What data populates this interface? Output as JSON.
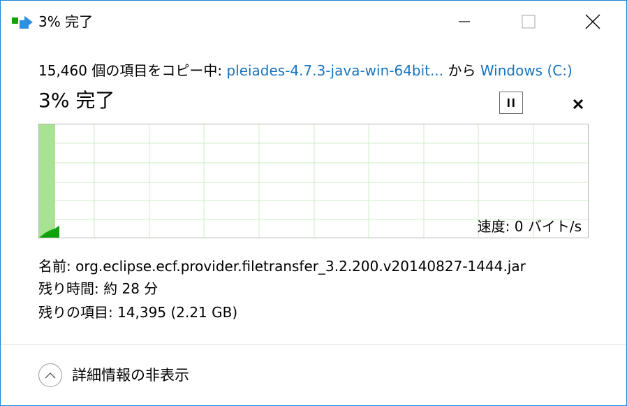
{
  "window": {
    "title": "3% 完了",
    "accent_color": "#1883d7",
    "icons": [
      "copy-progress-icon",
      "minimize-icon",
      "maximize-icon",
      "close-icon"
    ]
  },
  "copy": {
    "prefix": "15,460 個の項目をコピー中: ",
    "source": "pleiades-4.7.3-java-win-64bit...",
    "middle": " から ",
    "destination": "Windows (C:)"
  },
  "progress": {
    "label": "3% 完了",
    "percent": 3,
    "pause_icon": "pause-icon",
    "cancel_icon": "cancel-icon",
    "fill_color": "#a8e393",
    "line_color": "#0ea20e"
  },
  "graph": {
    "speed_label": "速度: 0 バイト/s"
  },
  "info": {
    "name_label": "名前: ",
    "name_value": "org.eclipse.ecf.provider.filetransfer_3.2.200.v20140827-1444.jar",
    "time_label": "残り時間: ",
    "time_value": "約 28 分",
    "items_label": "残りの項目: ",
    "items_value": "14,395 (2.21 GB)"
  },
  "details": {
    "label": "詳細情報の非表示",
    "icon": "chevron-up-icon"
  }
}
